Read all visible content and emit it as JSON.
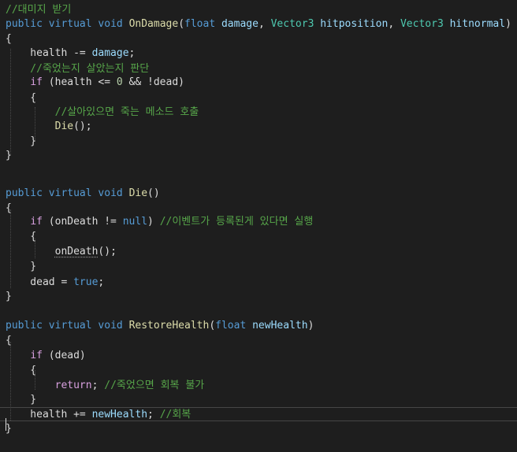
{
  "theme": {
    "background": "#1e1e1e",
    "keyword": "#569cd6",
    "type": "#4ec9b0",
    "function": "#dcdcaa",
    "parameter": "#9cdcfe",
    "plain": "#dcdcdc",
    "number": "#b5cea8",
    "comment": "#57a64a",
    "control": "#d8a0df"
  },
  "code_lines": [
    [
      {
        "t": "//대미지 받기",
        "c": "comment"
      }
    ],
    [
      {
        "t": "public",
        "c": "kw"
      },
      {
        "t": " ",
        "c": "plain"
      },
      {
        "t": "virtual",
        "c": "kw"
      },
      {
        "t": " ",
        "c": "plain"
      },
      {
        "t": "void",
        "c": "kw"
      },
      {
        "t": " ",
        "c": "plain"
      },
      {
        "t": "OnDamage",
        "c": "fn"
      },
      {
        "t": "(",
        "c": "plain"
      },
      {
        "t": "float",
        "c": "kw"
      },
      {
        "t": " ",
        "c": "plain"
      },
      {
        "t": "damage",
        "c": "param"
      },
      {
        "t": ", ",
        "c": "plain"
      },
      {
        "t": "Vector3",
        "c": "type"
      },
      {
        "t": " ",
        "c": "plain"
      },
      {
        "t": "hitposition",
        "c": "param"
      },
      {
        "t": ", ",
        "c": "plain"
      },
      {
        "t": "Vector3",
        "c": "type"
      },
      {
        "t": " ",
        "c": "plain"
      },
      {
        "t": "hitnormal",
        "c": "param"
      },
      {
        "t": ")",
        "c": "plain"
      }
    ],
    [
      {
        "t": "{",
        "c": "plain"
      }
    ],
    [
      {
        "t": "    health -= ",
        "c": "plain"
      },
      {
        "t": "damage",
        "c": "param"
      },
      {
        "t": ";",
        "c": "plain"
      }
    ],
    [
      {
        "t": "    //죽었는지 살았는지 판단",
        "c": "comment"
      }
    ],
    [
      {
        "t": "    ",
        "c": "plain"
      },
      {
        "t": "if",
        "c": "ctrl"
      },
      {
        "t": " (health <= ",
        "c": "plain"
      },
      {
        "t": "0",
        "c": "num"
      },
      {
        "t": " && !dead)",
        "c": "plain"
      }
    ],
    [
      {
        "t": "    {",
        "c": "plain"
      }
    ],
    [
      {
        "t": "        //살아있으면 죽는 메소드 호출",
        "c": "comment"
      }
    ],
    [
      {
        "t": "        ",
        "c": "plain"
      },
      {
        "t": "Die",
        "c": "fn"
      },
      {
        "t": "();",
        "c": "plain"
      }
    ],
    [
      {
        "t": "    }",
        "c": "plain"
      }
    ],
    [
      {
        "t": "}",
        "c": "plain"
      }
    ],
    [],
    [],
    [
      {
        "t": "public",
        "c": "kw"
      },
      {
        "t": " ",
        "c": "plain"
      },
      {
        "t": "virtual",
        "c": "kw"
      },
      {
        "t": " ",
        "c": "plain"
      },
      {
        "t": "void",
        "c": "kw"
      },
      {
        "t": " ",
        "c": "plain"
      },
      {
        "t": "Die",
        "c": "fn"
      },
      {
        "t": "()",
        "c": "plain"
      }
    ],
    [
      {
        "t": "{",
        "c": "plain"
      }
    ],
    [
      {
        "t": "    ",
        "c": "plain"
      },
      {
        "t": "if",
        "c": "ctrl"
      },
      {
        "t": " (onDeath != ",
        "c": "plain"
      },
      {
        "t": "null",
        "c": "kw"
      },
      {
        "t": ") ",
        "c": "plain"
      },
      {
        "t": "//이벤트가 등록된게 있다면 실행",
        "c": "comment"
      }
    ],
    [
      {
        "t": "    {",
        "c": "plain"
      }
    ],
    [
      {
        "t": "        ",
        "c": "plain"
      },
      {
        "t": "onDeath",
        "c": "plain",
        "sq": true
      },
      {
        "t": "();",
        "c": "plain"
      }
    ],
    [
      {
        "t": "    }",
        "c": "plain"
      }
    ],
    [
      {
        "t": "    dead = ",
        "c": "plain"
      },
      {
        "t": "true",
        "c": "kw"
      },
      {
        "t": ";",
        "c": "plain"
      }
    ],
    [
      {
        "t": "}",
        "c": "plain"
      }
    ],
    [],
    [],
    [
      {
        "t": "public",
        "c": "kw"
      },
      {
        "t": " ",
        "c": "plain"
      },
      {
        "t": "virtual",
        "c": "kw"
      },
      {
        "t": " ",
        "c": "plain"
      },
      {
        "t": "void",
        "c": "kw"
      },
      {
        "t": " ",
        "c": "plain"
      },
      {
        "t": "RestoreHealth",
        "c": "fn"
      },
      {
        "t": "(",
        "c": "plain"
      },
      {
        "t": "float",
        "c": "kw"
      },
      {
        "t": " ",
        "c": "plain"
      },
      {
        "t": "newHealth",
        "c": "param"
      },
      {
        "t": ")",
        "c": "plain"
      }
    ],
    [
      {
        "t": "{",
        "c": "plain"
      }
    ],
    [
      {
        "t": "    ",
        "c": "plain"
      },
      {
        "t": "if",
        "c": "ctrl"
      },
      {
        "t": " (dead)",
        "c": "plain"
      }
    ],
    [
      {
        "t": "    {",
        "c": "plain"
      }
    ],
    [
      {
        "t": "        ",
        "c": "plain"
      },
      {
        "t": "return",
        "c": "ctrl"
      },
      {
        "t": "; ",
        "c": "plain"
      },
      {
        "t": "//죽었으면 회복 불가",
        "c": "comment"
      }
    ],
    [
      {
        "t": "    }",
        "c": "plain"
      }
    ],
    [
      {
        "t": "    health += ",
        "c": "plain"
      },
      {
        "t": "newHealth",
        "c": "param"
      },
      {
        "t": "; ",
        "c": "plain"
      },
      {
        "t": "//회복",
        "c": "comment"
      }
    ],
    [
      {
        "t": "}",
        "c": "plain"
      }
    ]
  ],
  "current_line_index": 29
}
